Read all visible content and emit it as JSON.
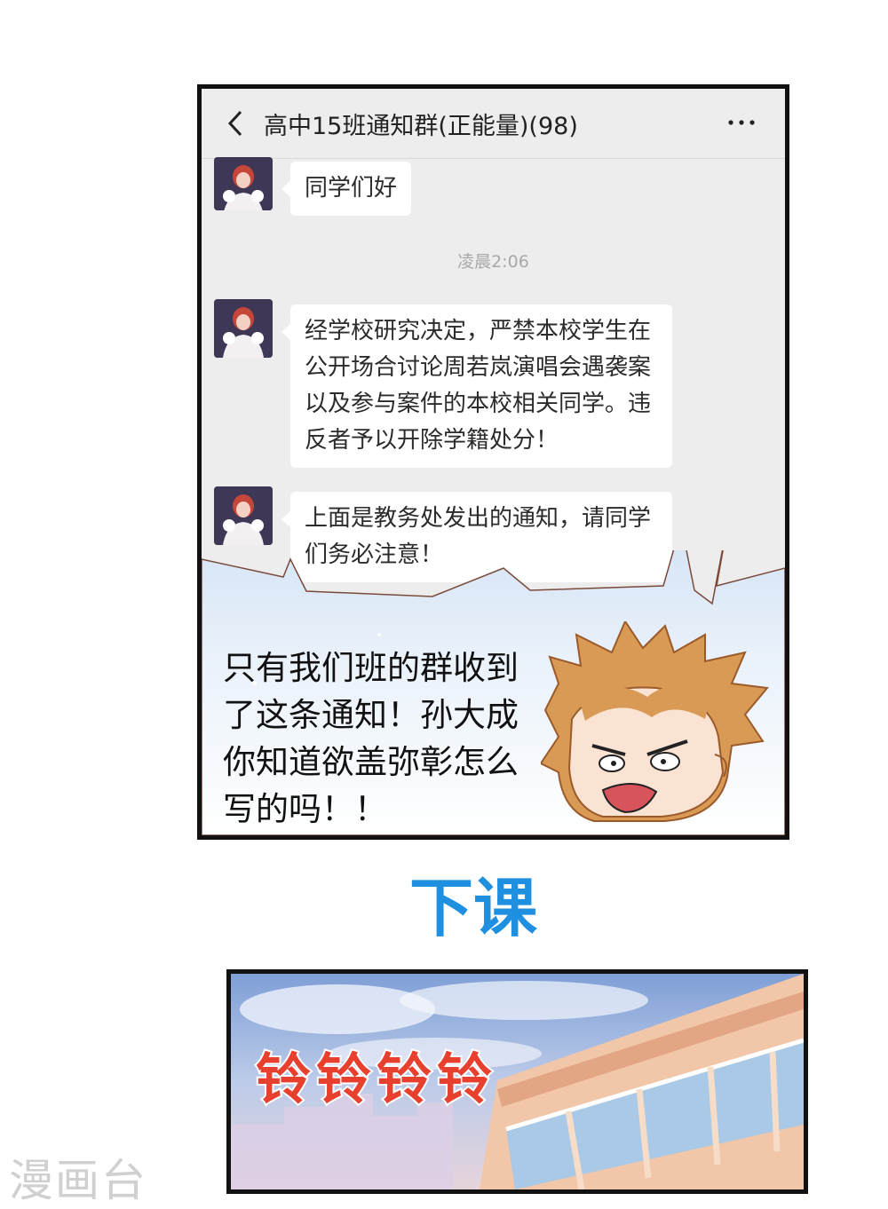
{
  "chat": {
    "title": "高中15班通知群(正能量)(98)",
    "icons": {
      "back": "chevron-left-icon",
      "more": "more-horizontal-icon"
    },
    "messages": [
      {
        "text": "同学们好"
      },
      {
        "text": "经学校研究决定，严禁本校学生在公开场合讨论周若岚演唱会遇袭案以及参与案件的本校相关同学。违反者予以开除学籍处分！"
      },
      {
        "text": "上面是教务处发出的通知，请同学们务必注意！"
      }
    ],
    "timestamp": "凌晨2:06"
  },
  "caption": "只有我们班的群收到了这条通知！孙大成你知道欲盖弥彰怎么写的吗！！",
  "scene_title": "下课",
  "sound_effect": "铃铃铃铃",
  "watermark": "漫画台",
  "colors": {
    "chat_bg": "#ededed",
    "bubble": "#ffffff",
    "title_blue": "#1f8fe0",
    "sfx_red": "#e8402f"
  }
}
